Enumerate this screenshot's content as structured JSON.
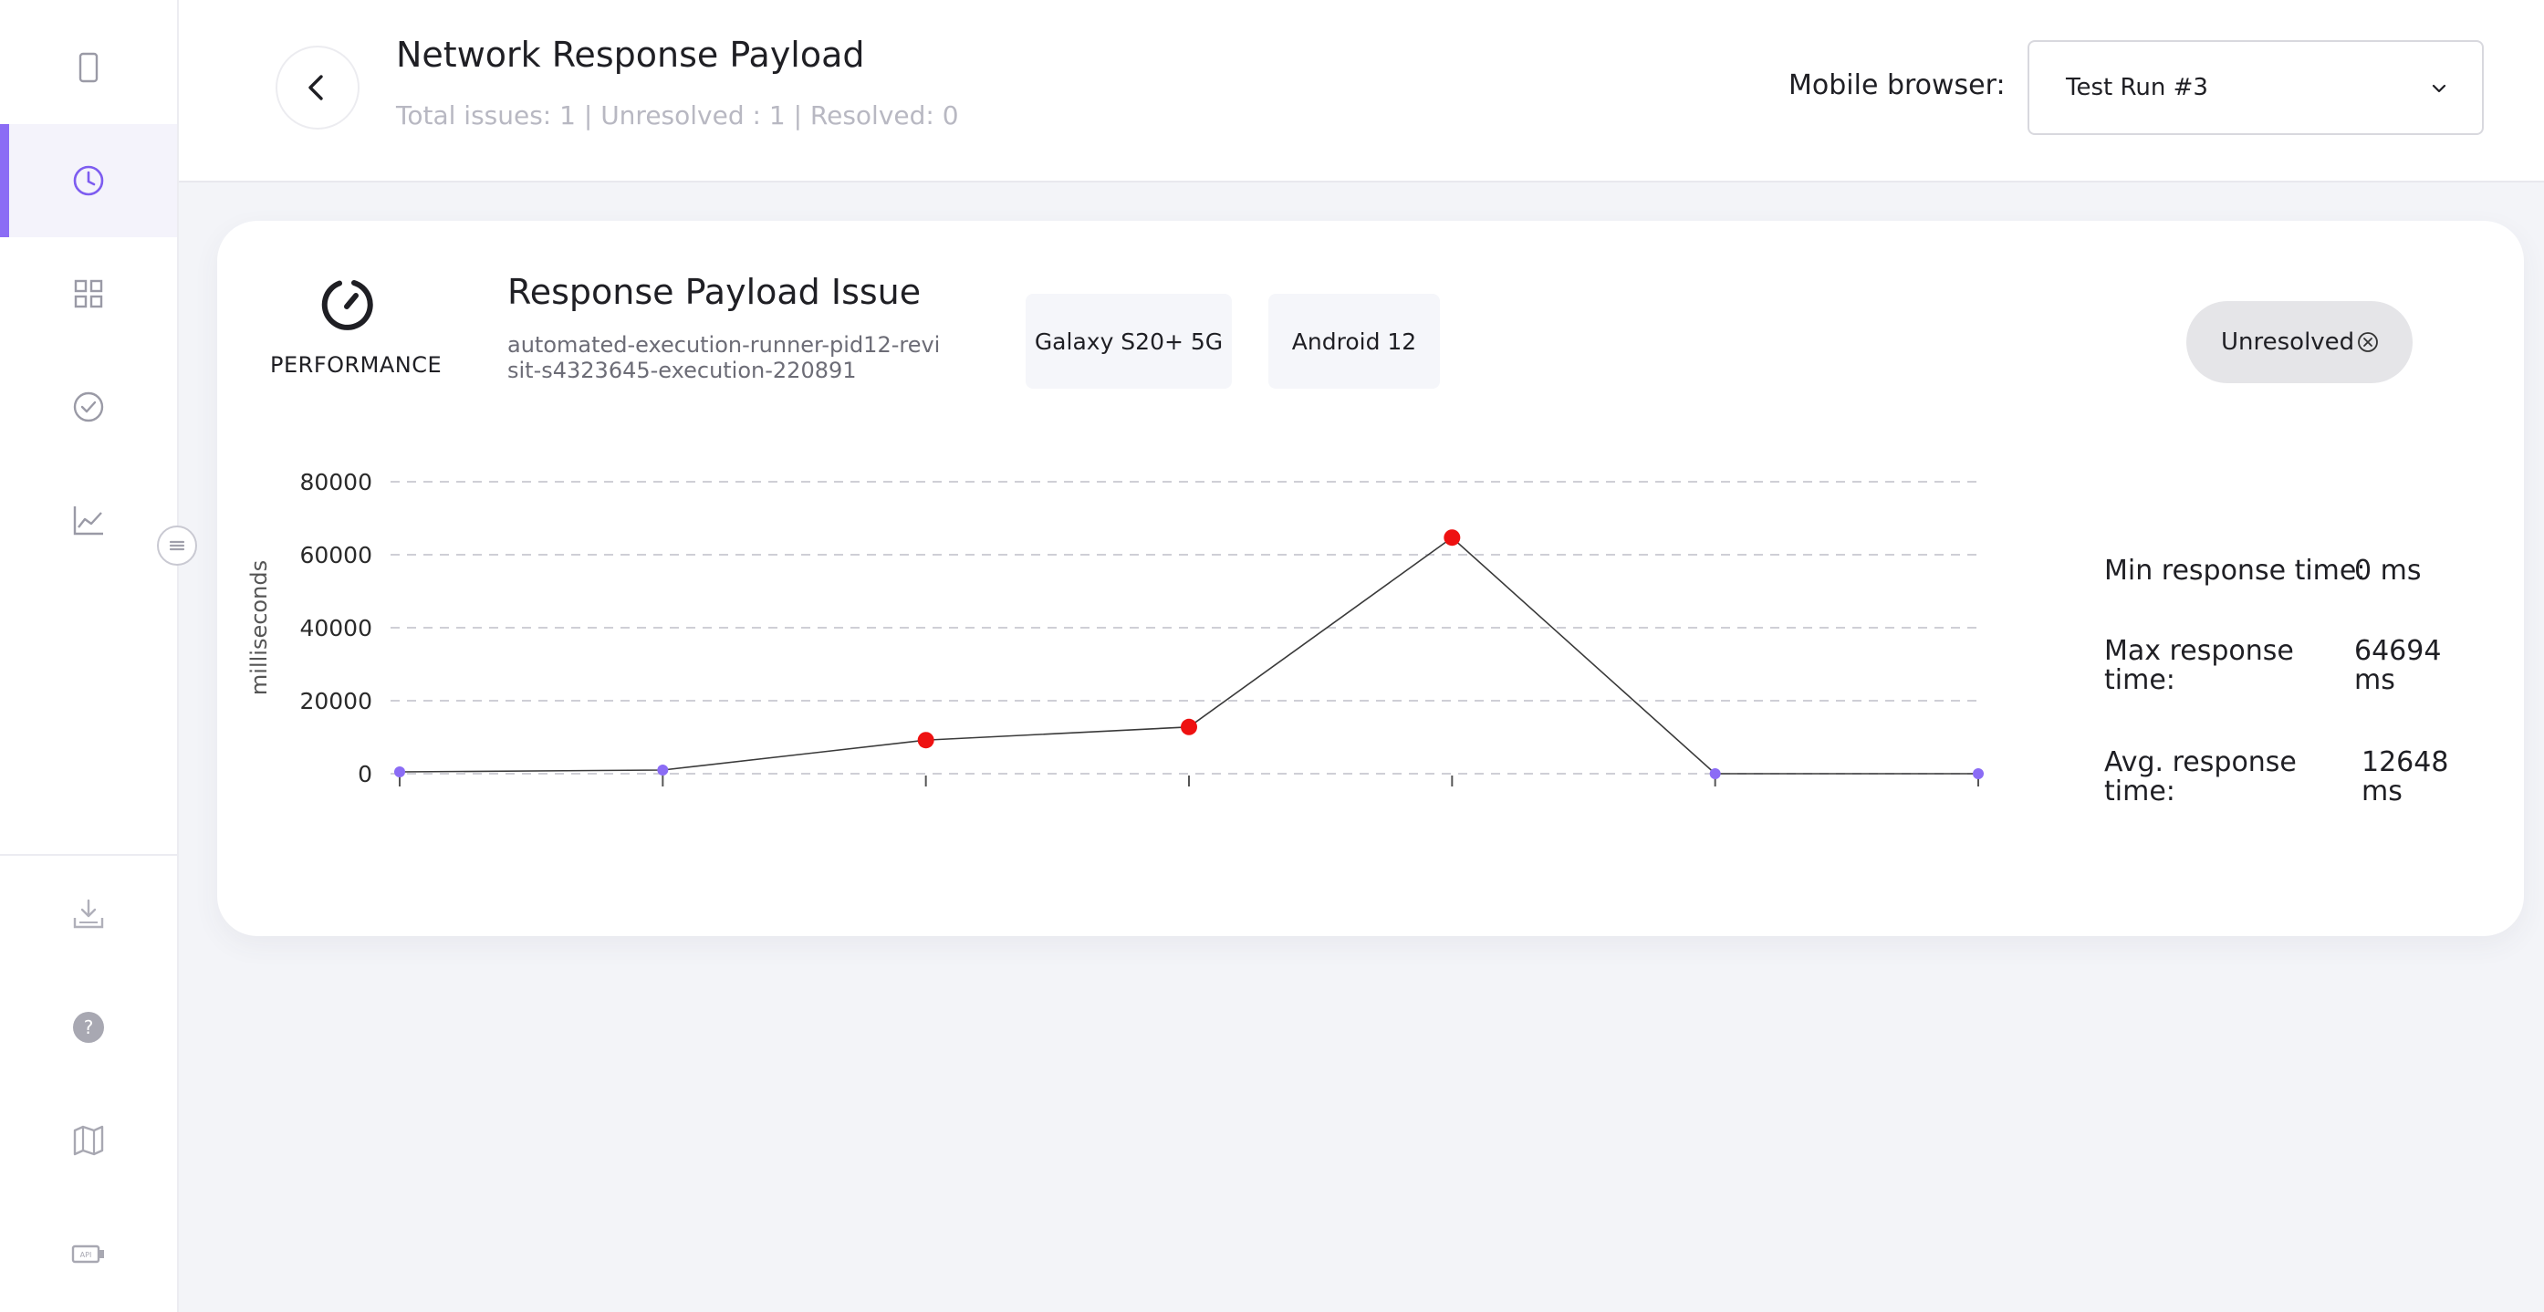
{
  "sidebar": {
    "items": [
      {
        "icon": "mobile-device-icon",
        "active": false
      },
      {
        "icon": "clock-icon",
        "active": true
      },
      {
        "icon": "grid-icon",
        "active": false
      },
      {
        "icon": "check-circle-icon",
        "active": false
      },
      {
        "icon": "line-chart-icon",
        "active": false
      }
    ],
    "bottom_items": [
      {
        "icon": "download-icon"
      },
      {
        "icon": "help-icon"
      },
      {
        "icon": "map-icon"
      },
      {
        "icon": "api-icon"
      }
    ],
    "accent_color": "#8b6cf5"
  },
  "header": {
    "title": "Network Response Payload",
    "subtitle": "Total issues: 1 | Unresolved : 1 | Resolved: 0",
    "browser_label": "Mobile browser:",
    "browser_value": "Test Run #3"
  },
  "issue": {
    "category": "PERFORMANCE",
    "title": "Response Payload Issue",
    "path": "automated-execution-runner-pid12-revisit-s4323645-execution-220891",
    "device": "Galaxy S20+ 5G",
    "os": "Android 12",
    "status": "Unresolved"
  },
  "stats": {
    "min_label": "Min response time:",
    "min_value": "0 ms",
    "max_label_1": "Max response",
    "max_label_2": "time:",
    "max_value_1": "64694",
    "max_value_2": "ms",
    "avg_label_1": "Avg. response",
    "avg_label_2": "time:",
    "avg_value_1": "12648",
    "avg_value_2": "ms"
  },
  "chart_data": {
    "type": "line",
    "ylabel": "milliseconds",
    "ylim": [
      0,
      80000
    ],
    "yticks": [
      0,
      20000,
      40000,
      60000,
      80000
    ],
    "ytick_labels": [
      "0",
      "20000",
      "40000",
      "60000",
      "80000"
    ],
    "x": [
      0,
      1,
      2,
      3,
      4,
      5,
      6
    ],
    "values": [
      500,
      1000,
      9200,
      12800,
      64694,
      0,
      0
    ],
    "flagged": [
      false,
      false,
      true,
      true,
      true,
      false,
      false
    ],
    "grid": true,
    "colors": {
      "line": "#3a3a3a",
      "normal_point": "#8b6cf5",
      "flagged_point": "#ee1111",
      "grid": "#cfcfd6"
    }
  }
}
